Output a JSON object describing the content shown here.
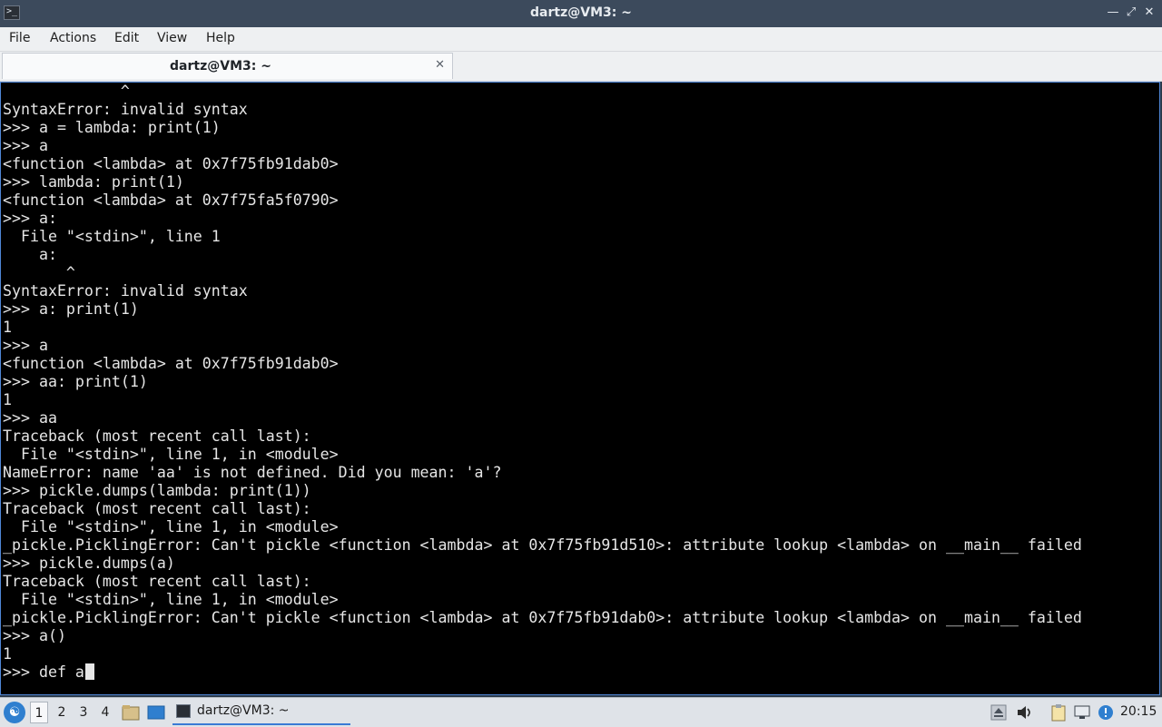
{
  "window": {
    "title": "dartz@VM3: ~"
  },
  "menubar": {
    "items": [
      "File",
      "Actions",
      "Edit",
      "View",
      "Help"
    ]
  },
  "tab": {
    "label": "dartz@VM3: ~"
  },
  "terminal": {
    "lines": [
      "             ^",
      "SyntaxError: invalid syntax",
      ">>> a = lambda: print(1)",
      ">>> a",
      "<function <lambda> at 0x7f75fb91dab0>",
      ">>> lambda: print(1)",
      "<function <lambda> at 0x7f75fa5f0790>",
      ">>> a:",
      "  File \"<stdin>\", line 1",
      "    a:",
      "       ^",
      "SyntaxError: invalid syntax",
      ">>> a: print(1)",
      "1",
      ">>> a",
      "<function <lambda> at 0x7f75fb91dab0>",
      ">>> aa: print(1)",
      "1",
      ">>> aa",
      "Traceback (most recent call last):",
      "  File \"<stdin>\", line 1, in <module>",
      "NameError: name 'aa' is not defined. Did you mean: 'a'?",
      ">>> pickle.dumps(lambda: print(1))",
      "Traceback (most recent call last):",
      "  File \"<stdin>\", line 1, in <module>",
      "_pickle.PicklingError: Can't pickle <function <lambda> at 0x7f75fb91d510>: attribute lookup <lambda> on __main__ failed",
      ">>> pickle.dumps(a)",
      "Traceback (most recent call last):",
      "  File \"<stdin>\", line 1, in <module>",
      "_pickle.PicklingError: Can't pickle <function <lambda> at 0x7f75fb91dab0>: attribute lookup <lambda> on __main__ failed",
      ">>> a()",
      "1"
    ],
    "current_input": ">>> def a"
  },
  "taskbar": {
    "workspaces": [
      "1",
      "2",
      "3",
      "4"
    ],
    "active_workspace": "1",
    "task_label": "dartz@VM3: ~",
    "clock": "20:15"
  },
  "colors": {
    "accent": "#3a7bd5",
    "terminal_bg": "#000000",
    "terminal_fg": "#e6e6e6",
    "titlebar": "#3c4a5c"
  }
}
